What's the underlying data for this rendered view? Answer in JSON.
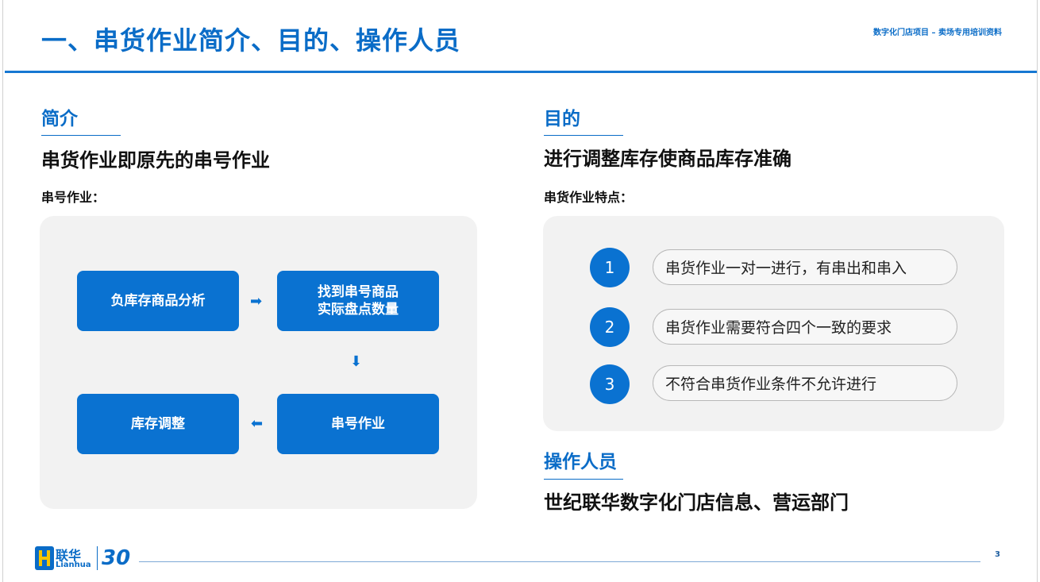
{
  "header": {
    "title": "一、串货作业简介、目的、操作人员",
    "subtitle": "数字化门店项目 – 卖场专用培训资料"
  },
  "intro": {
    "heading": "简介",
    "lead": "串货作业即原先的串号作业",
    "sublabel": "串号作业：",
    "flow": {
      "step1": "负库存商品分析",
      "step2": "找到串号商品\n实际盘点数量",
      "step3": "串号作业",
      "step4": "库存调整",
      "arrow_right": "➡",
      "arrow_down": "⬇",
      "arrow_left": "⬅"
    }
  },
  "purpose": {
    "heading": "目的",
    "lead": "进行调整库存使商品库存准确",
    "sublabel": "串货作业特点：",
    "features": [
      {
        "num": "1",
        "text": "串货作业一对一进行，有串出和串入"
      },
      {
        "num": "2",
        "text": "串货作业需要符合四个一致的要求"
      },
      {
        "num": "3",
        "text": "不符合串货作业条件不允许进行"
      }
    ]
  },
  "operators": {
    "heading": "操作人员",
    "lead": "世纪联华数字化门店信息、营运部门"
  },
  "footer": {
    "logo_cn": "联华",
    "logo_en": "Lianhua",
    "logo_badge": "30",
    "page_number": "3"
  },
  "colors": {
    "accent": "#0a6cc7",
    "box": "#0a72d1",
    "panel": "#f2f2f2"
  }
}
